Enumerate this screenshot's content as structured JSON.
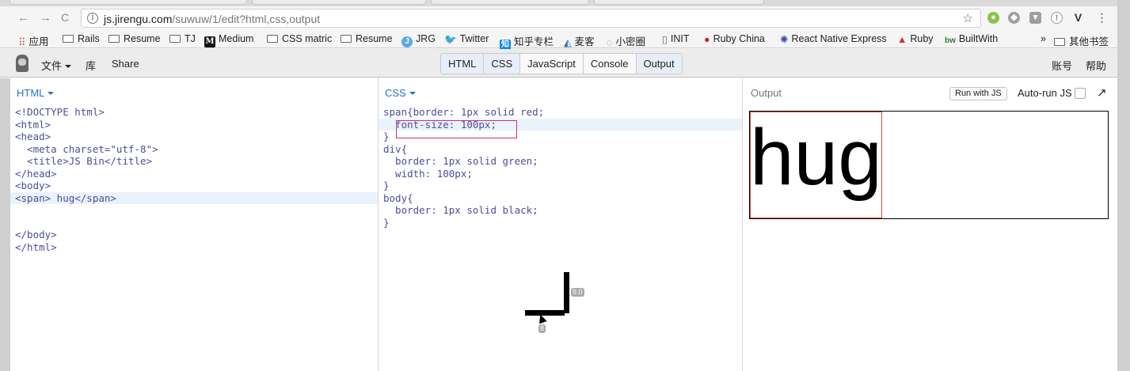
{
  "browser": {
    "url_host": "js.jirengu.com",
    "url_path": "/suwuw/1/edit?html,css,output",
    "nav": {
      "back": "←",
      "forward": "→",
      "reload": "C"
    }
  },
  "bookmarks": [
    {
      "label": "应用",
      "icon": "apps-grid-icon"
    },
    {
      "label": "Rails",
      "icon": "folder-icon"
    },
    {
      "label": "Resume",
      "icon": "folder-icon"
    },
    {
      "label": "TJ",
      "icon": "folder-icon"
    },
    {
      "label": "Medium",
      "icon": "medium-icon"
    },
    {
      "label": "CSS matric",
      "icon": "folder-icon"
    },
    {
      "label": "Resume",
      "icon": "folder-icon"
    },
    {
      "label": "JRG",
      "icon": "jrg-icon"
    },
    {
      "label": "Twitter",
      "icon": "twitter-icon"
    },
    {
      "label": "知乎专栏",
      "icon": "zhihu-icon"
    },
    {
      "label": "麦客",
      "icon": "maike-icon"
    },
    {
      "label": "小密圈",
      "icon": "circle-icon"
    },
    {
      "label": "INIT",
      "icon": "page-icon"
    },
    {
      "label": "Ruby China",
      "icon": "ruby-icon"
    },
    {
      "label": "React Native Express",
      "icon": "react-icon"
    },
    {
      "label": "Ruby",
      "icon": "ruby-red-icon"
    },
    {
      "label": "BuiltWith",
      "icon": "builtwith-icon"
    }
  ],
  "bookmarks_overflow": "»",
  "bookmarks_other": "其他书签",
  "jsbin": {
    "file_menu": "文件",
    "library": "库",
    "share": "Share",
    "tabs": [
      "HTML",
      "CSS",
      "JavaScript",
      "Console",
      "Output"
    ],
    "account": "账号",
    "help": "帮助"
  },
  "html_panel": {
    "label": "HTML",
    "lines": [
      "<!DOCTYPE html>",
      "<html>",
      "<head>",
      "  <meta charset=\"utf-8\">",
      "  <title>JS Bin</title>",
      "</head>",
      "<body>",
      "<span> hug</span>",
      "",
      "",
      "</body>",
      "</html>"
    ]
  },
  "css_panel": {
    "label": "CSS",
    "lines": [
      "span{border: 1px solid red;",
      "  font-size: 100px;",
      "}",
      "div{",
      "  border: 1px solid green;",
      "  width: 100px;",
      "}",
      "body{",
      "  border: 1px solid black;",
      "}"
    ]
  },
  "output_panel": {
    "label": "Output",
    "run_button": "Run with JS",
    "autorun_label": "Auto-run JS",
    "autorun_checked": false,
    "popout": "↗",
    "rendered_text": "hug"
  },
  "ruler": {
    "vertical_label": "9.0",
    "horizontal_label": "8"
  }
}
